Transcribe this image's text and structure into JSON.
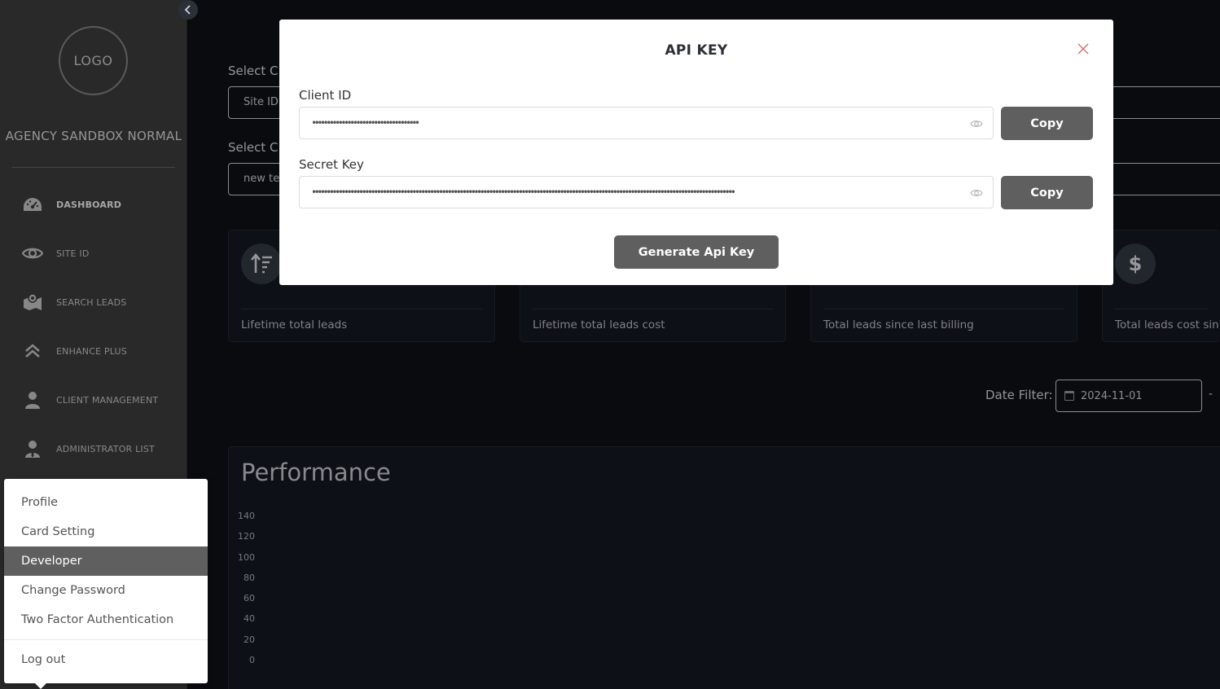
{
  "sidebar": {
    "collapse_icon": "chevron-left-icon",
    "logo_text": "LOGO",
    "agency_name": "AGENCY SANDBOX NORMAL",
    "items": [
      {
        "label": "DASHBOARD",
        "icon": "dashboard-gauge-icon",
        "active": true
      },
      {
        "label": "SITE ID",
        "icon": "eye-icon",
        "active": false
      },
      {
        "label": "SEARCH LEADS",
        "icon": "map-search-icon",
        "active": false
      },
      {
        "label": "ENHANCE PLUS",
        "icon": "double-chevron-up-icon",
        "active": false
      },
      {
        "label": "CLIENT MANAGEMENT",
        "icon": "user-icon",
        "active": false
      },
      {
        "label": "ADMINISTRATOR LIST",
        "icon": "admin-user-icon",
        "active": false
      }
    ]
  },
  "main": {
    "select_campaign_label": "Select C",
    "site_input_value": "Site ID",
    "select_client_label": "Select C",
    "client_input_value": "new te",
    "stats": [
      {
        "label": "Lifetime total leads",
        "icon": "sort-ascending-icon"
      },
      {
        "label": "Lifetime total leads cost",
        "icon": ""
      },
      {
        "label": "Total leads since last billing",
        "icon": ""
      },
      {
        "label": "Total leads cost sin",
        "icon": "dollar-icon"
      }
    ],
    "date_filter_label": "Date Filter:",
    "date_start": "2024-11-01",
    "date_separator": "-",
    "performance": {
      "title": "Performance",
      "y_ticks": [
        "140",
        "120",
        "100",
        "80",
        "60",
        "40",
        "20",
        "0"
      ]
    }
  },
  "modal": {
    "title": "API KEY",
    "close_icon": "close-icon",
    "client_id_label": "Client ID",
    "client_id_masked": "••••••••••••••••••••••••••••••••••••",
    "secret_key_label": "Secret Key",
    "secret_key_masked": "•••••••••••••••••••••••••••••••••••••••••••••••••••••••••••••••••••••••••••••••••••••••••••••••••••••••••••••••••••••••••••••••••••••••••••••••",
    "copy_label": "Copy",
    "generate_label": "Generate Api Key"
  },
  "dropdown": {
    "items": [
      {
        "label": "Profile",
        "active": false
      },
      {
        "label": "Card Setting",
        "active": false
      },
      {
        "label": "Developer",
        "active": true
      },
      {
        "label": "Change Password",
        "active": false
      },
      {
        "label": "Two Factor Authentication",
        "active": false
      }
    ],
    "logout_label": "Log out"
  },
  "colors": {
    "sidebar_bg": "#3f3f3f",
    "page_bg": "#0f1218",
    "button_bg": "#5f5f5f",
    "close_color": "#d66f6f"
  }
}
